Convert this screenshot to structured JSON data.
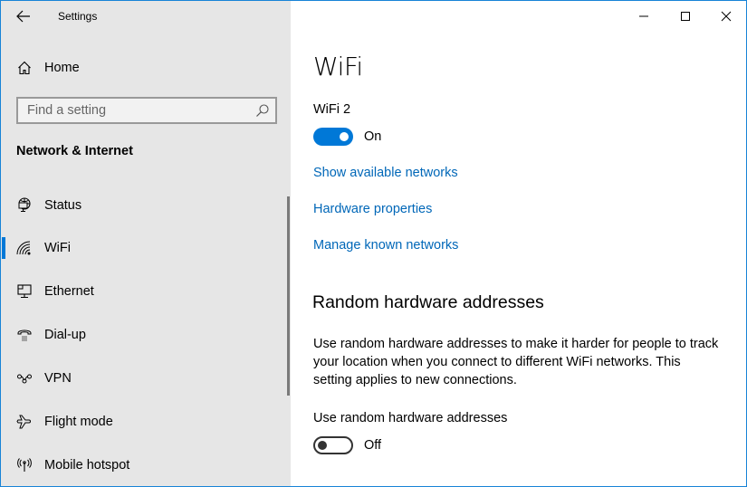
{
  "window": {
    "title": "Settings",
    "accent_color": "#0078d7",
    "link_color": "#0067b8",
    "controls": {
      "minimize": "minimize-icon",
      "maximize": "maximize-icon",
      "close": "close-icon"
    }
  },
  "sidebar": {
    "back_icon": "arrow-left-icon",
    "home": {
      "label": "Home",
      "icon": "home-icon"
    },
    "search": {
      "placeholder": "Find a setting",
      "value": "",
      "icon": "search-icon"
    },
    "section_title": "Network & Internet",
    "items": [
      {
        "label": "Status",
        "icon": "globe-monitor-icon",
        "active": false
      },
      {
        "label": "WiFi",
        "icon": "wifi-icon",
        "active": true
      },
      {
        "label": "Ethernet",
        "icon": "ethernet-icon",
        "active": false
      },
      {
        "label": "Dial-up",
        "icon": "phone-icon",
        "active": false
      },
      {
        "label": "VPN",
        "icon": "vpn-icon",
        "active": false
      },
      {
        "label": "Flight mode",
        "icon": "airplane-icon",
        "active": false
      },
      {
        "label": "Mobile hotspot",
        "icon": "hotspot-icon",
        "active": false
      }
    ]
  },
  "main": {
    "title": "WiFi",
    "adapter": {
      "label": "WiFi 2",
      "toggle_state": "On",
      "toggle_on": true
    },
    "links": [
      "Show available networks",
      "Hardware properties",
      "Manage known networks"
    ],
    "random_section": {
      "heading": "Random hardware addresses",
      "description": "Use random hardware addresses to make it harder for people to track your location when you connect to different WiFi networks. This setting applies to new connections.",
      "toggle_label": "Use random hardware addresses",
      "toggle_state": "Off",
      "toggle_on": false
    }
  }
}
